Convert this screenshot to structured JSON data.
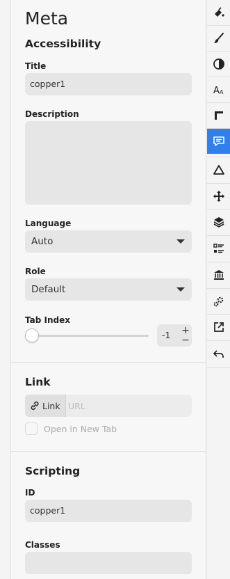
{
  "panel": {
    "title": "Meta",
    "accessibility": {
      "heading": "Accessibility",
      "title_label": "Title",
      "title_value": "copper1",
      "description_label": "Description",
      "description_value": "",
      "language_label": "Language",
      "language_value": "Auto",
      "role_label": "Role",
      "role_value": "Default",
      "tab_index_label": "Tab Index",
      "tab_index_value": "-1",
      "tab_index_plus": "+",
      "tab_index_minus": "−"
    },
    "link": {
      "heading": "Link",
      "toggle_label": "Link",
      "url_placeholder": "URL",
      "new_tab_label": "Open in New Tab"
    },
    "scripting": {
      "heading": "Scripting",
      "id_label": "ID",
      "id_value": "copper1",
      "classes_label": "Classes",
      "classes_value": ""
    }
  },
  "toolbar": {
    "items": [
      {
        "icon": "paint-bucket-icon"
      },
      {
        "icon": "brush-icon"
      },
      {
        "icon": "contrast-icon"
      },
      {
        "icon": "typography-icon"
      },
      {
        "icon": "ruler-icon"
      },
      {
        "icon": "comment-icon",
        "active": true
      },
      {
        "icon": "triangle-icon"
      },
      {
        "icon": "move-icon"
      },
      {
        "icon": "layers-icon"
      },
      {
        "icon": "list-icon"
      },
      {
        "icon": "bank-icon"
      },
      {
        "icon": "gears-icon"
      },
      {
        "icon": "external-link-icon"
      },
      {
        "icon": "undo-icon"
      }
    ],
    "accent_color": "#2f80ed"
  }
}
